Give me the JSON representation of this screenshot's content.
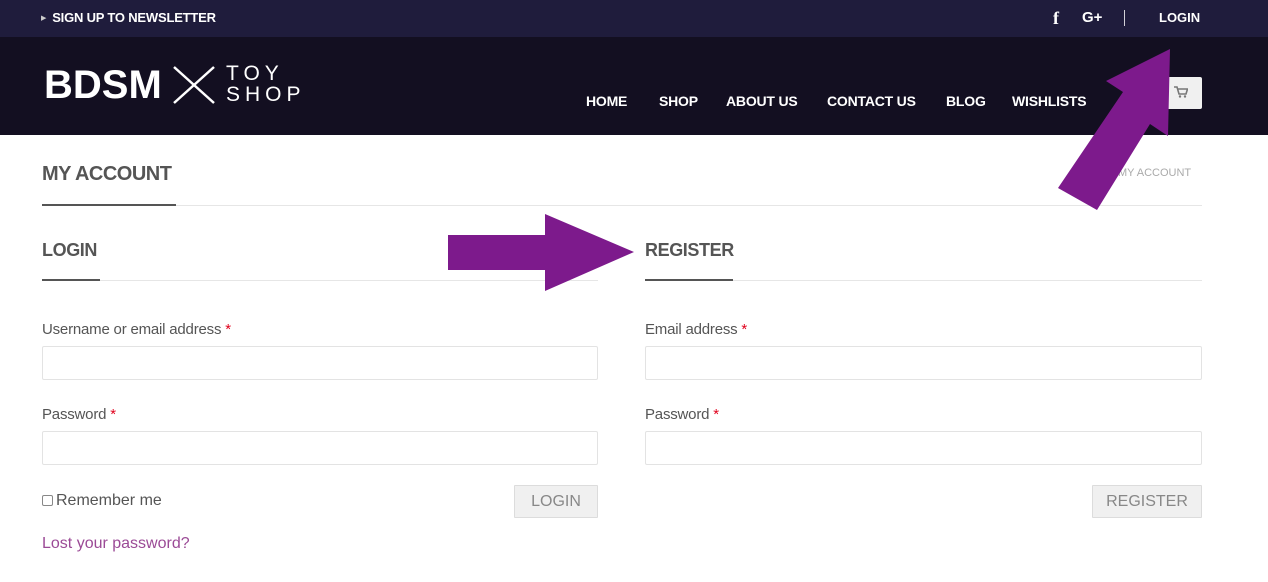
{
  "topbar": {
    "newsletter": "SIGN UP TO NEWSLETTER",
    "facebook": "f",
    "googleplus": "G+",
    "login": "LOGIN"
  },
  "logo": {
    "word1": "BDSM",
    "word2": "TOY",
    "word3": "SHOP"
  },
  "nav": {
    "items": [
      {
        "label": "HOME"
      },
      {
        "label": "SHOP"
      },
      {
        "label": "ABOUT US"
      },
      {
        "label": "CONTACT US"
      },
      {
        "label": "BLOG"
      },
      {
        "label": "WISHLISTS"
      }
    ]
  },
  "cart_icon": "cart-icon",
  "page": {
    "title": "MY ACCOUNT",
    "breadcrumb": "MY ACCOUNT"
  },
  "login": {
    "heading": "LOGIN",
    "username_label": "Username or email address",
    "password_label": "Password",
    "required_mark": "*",
    "remember": "Remember me",
    "button": "LOGIN",
    "lost_password": "Lost your password?"
  },
  "register": {
    "heading": "REGISTER",
    "email_label": "Email address",
    "password_label": "Password",
    "required_mark": "*",
    "button": "REGISTER"
  },
  "colors": {
    "topbar": "#1f1c3c",
    "header": "#130f21",
    "arrow": "#7d1a8c",
    "link": "#9b4a96",
    "required": "#e0001b"
  }
}
